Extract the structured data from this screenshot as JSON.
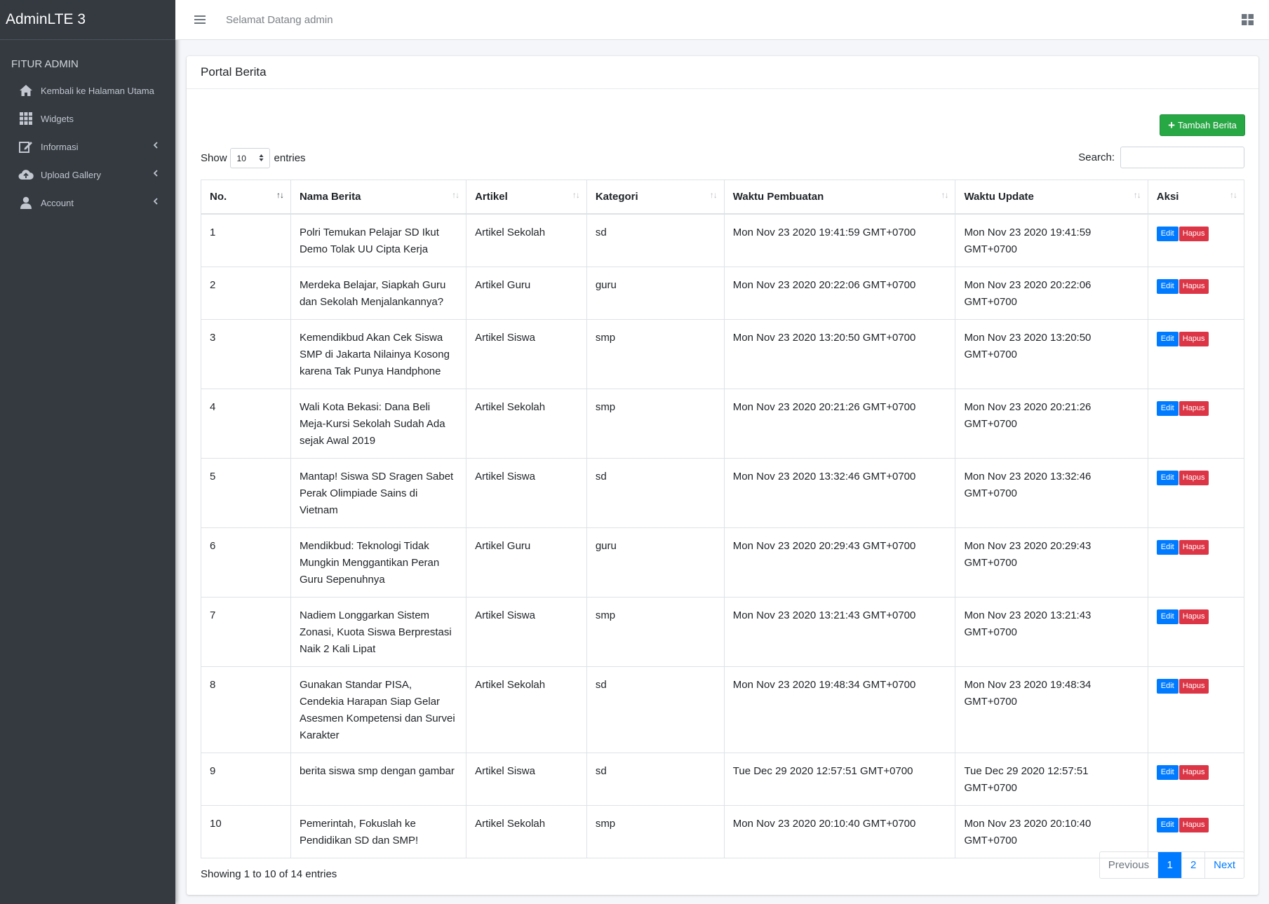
{
  "sidebar": {
    "brand": "AdminLTE 3",
    "header": "FITUR ADMIN",
    "items": [
      {
        "label": "Kembali ke Halaman Utama",
        "icon": "home-icon"
      },
      {
        "label": "Widgets",
        "icon": "grid-icon"
      },
      {
        "label": "Informasi",
        "icon": "edit-icon"
      },
      {
        "label": "Upload Gallery",
        "icon": "cloud-upload-icon"
      },
      {
        "label": "Account",
        "icon": "user-icon"
      }
    ]
  },
  "topbar": {
    "welcome": "Selamat Datang admin"
  },
  "card": {
    "title": "Portal Berita",
    "add_label": "Tambah Berita",
    "show_label": "Show",
    "entries_label": "entries",
    "page_size": "10",
    "search_label": "Search:"
  },
  "table": {
    "columns": [
      "No.",
      "Nama Berita",
      "Artikel",
      "Kategori",
      "Waktu Pembuatan",
      "Waktu Update",
      "Aksi"
    ],
    "edit_label": "Edit",
    "delete_label": "Hapus",
    "rows": [
      {
        "no": "1",
        "nama": "Polri Temukan Pelajar SD Ikut Demo Tolak UU Cipta Kerja",
        "artikel": "Artikel Sekolah",
        "kategori": "sd",
        "dibuat": "Mon Nov 23 2020 19:41:59 GMT+0700",
        "update": "Mon Nov 23 2020 19:41:59 GMT+0700"
      },
      {
        "no": "2",
        "nama": "Merdeka Belajar, Siapkah Guru dan Sekolah Menjalankannya?",
        "artikel": "Artikel Guru",
        "kategori": "guru",
        "dibuat": "Mon Nov 23 2020 20:22:06 GMT+0700",
        "update": "Mon Nov 23 2020 20:22:06 GMT+0700"
      },
      {
        "no": "3",
        "nama": "Kemendikbud Akan Cek Siswa SMP di Jakarta Nilainya Kosong karena Tak Punya Handphone",
        "artikel": "Artikel Siswa",
        "kategori": "smp",
        "dibuat": "Mon Nov 23 2020 13:20:50 GMT+0700",
        "update": "Mon Nov 23 2020 13:20:50 GMT+0700"
      },
      {
        "no": "4",
        "nama": "Wali Kota Bekasi: Dana Beli Meja-Kursi Sekolah Sudah Ada sejak Awal 2019",
        "artikel": "Artikel Sekolah",
        "kategori": "smp",
        "dibuat": "Mon Nov 23 2020 20:21:26 GMT+0700",
        "update": "Mon Nov 23 2020 20:21:26 GMT+0700"
      },
      {
        "no": "5",
        "nama": "Mantap! Siswa SD Sragen Sabet Perak Olimpiade Sains di Vietnam",
        "artikel": "Artikel Siswa",
        "kategori": "sd",
        "dibuat": "Mon Nov 23 2020 13:32:46 GMT+0700",
        "update": "Mon Nov 23 2020 13:32:46 GMT+0700"
      },
      {
        "no": "6",
        "nama": "Mendikbud: Teknologi Tidak Mungkin Menggantikan Peran Guru Sepenuhnya",
        "artikel": "Artikel Guru",
        "kategori": "guru",
        "dibuat": "Mon Nov 23 2020 20:29:43 GMT+0700",
        "update": "Mon Nov 23 2020 20:29:43 GMT+0700"
      },
      {
        "no": "7",
        "nama": "Nadiem Longgarkan Sistem Zonasi, Kuota Siswa Berprestasi Naik 2 Kali Lipat",
        "artikel": "Artikel Siswa",
        "kategori": "smp",
        "dibuat": "Mon Nov 23 2020 13:21:43 GMT+0700",
        "update": "Mon Nov 23 2020 13:21:43 GMT+0700"
      },
      {
        "no": "8",
        "nama": "Gunakan Standar PISA, Cendekia Harapan Siap Gelar Asesmen Kompetensi dan Survei Karakter",
        "artikel": "Artikel Sekolah",
        "kategori": "sd",
        "dibuat": "Mon Nov 23 2020 19:48:34 GMT+0700",
        "update": "Mon Nov 23 2020 19:48:34 GMT+0700"
      },
      {
        "no": "9",
        "nama": "berita siswa smp dengan gambar",
        "artikel": "Artikel Siswa",
        "kategori": "sd",
        "dibuat": "Tue Dec 29 2020 12:57:51 GMT+0700",
        "update": "Tue Dec 29 2020 12:57:51 GMT+0700"
      },
      {
        "no": "10",
        "nama": "Pemerintah, Fokuslah ke Pendidikan SD dan SMP!",
        "artikel": "Artikel Sekolah",
        "kategori": "smp",
        "dibuat": "Mon Nov 23 2020 20:10:40 GMT+0700",
        "update": "Mon Nov 23 2020 20:10:40 GMT+0700"
      }
    ]
  },
  "footer": {
    "info": "Showing 1 to 10 of 14 entries",
    "previous": "Previous",
    "pages": [
      "1",
      "2"
    ],
    "next": "Next"
  },
  "colors": {
    "sidebar_bg": "#343a40",
    "primary": "#007bff",
    "success": "#28a745",
    "danger": "#dc3545"
  }
}
